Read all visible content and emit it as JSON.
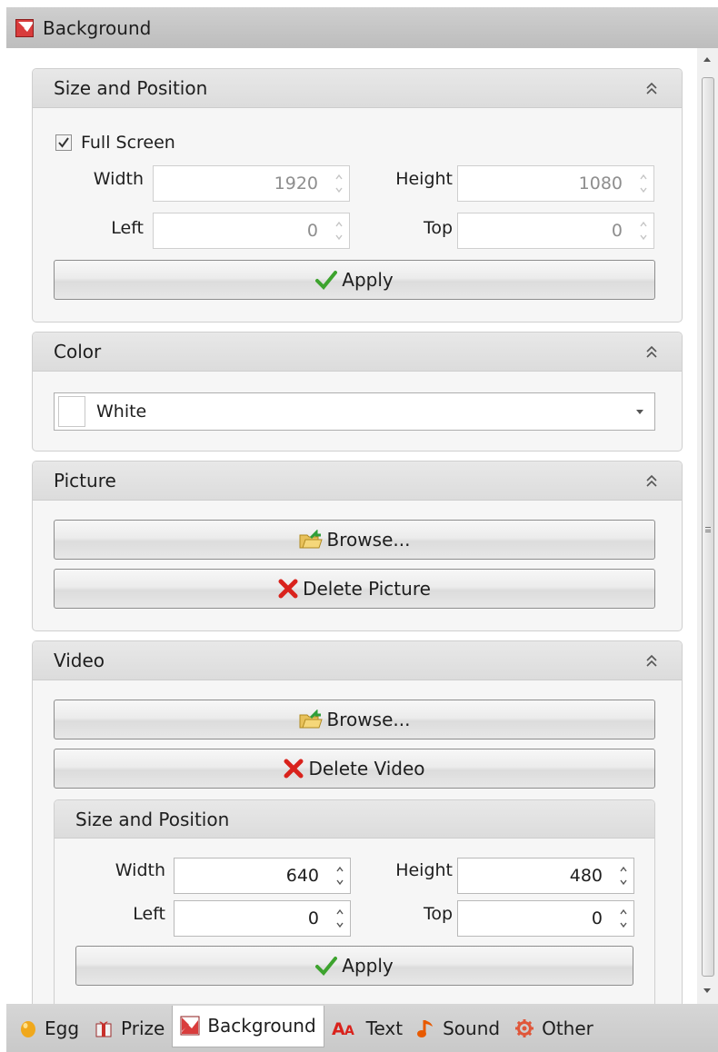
{
  "window": {
    "title": "Background",
    "title_icon": "background-app-icon"
  },
  "size_position": {
    "header": "Size and Position",
    "full_screen_label": "Full Screen",
    "full_screen_checked": true,
    "width_label": "Width",
    "width_value": "1920",
    "height_label": "Height",
    "height_value": "1080",
    "left_label": "Left",
    "left_value": "0",
    "top_label": "Top",
    "top_value": "0",
    "apply_label": "Apply"
  },
  "color": {
    "header": "Color",
    "selected": "White",
    "swatch": "#ffffff"
  },
  "picture": {
    "header": "Picture",
    "browse_label": "Browse...",
    "delete_label": "Delete Picture"
  },
  "video": {
    "header": "Video",
    "browse_label": "Browse...",
    "delete_label": "Delete Video",
    "size_position": {
      "header": "Size and Position",
      "width_label": "Width",
      "width_value": "640",
      "height_label": "Height",
      "height_value": "480",
      "left_label": "Left",
      "left_value": "0",
      "top_label": "Top",
      "top_value": "0",
      "apply_label": "Apply"
    }
  },
  "tabs": [
    {
      "label": "Egg",
      "icon": "egg-icon",
      "active": false
    },
    {
      "label": "Prize",
      "icon": "prize-icon",
      "active": false
    },
    {
      "label": "Background",
      "icon": "background-icon",
      "active": true
    },
    {
      "label": "Text",
      "icon": "text-icon",
      "active": false
    },
    {
      "label": "Sound",
      "icon": "sound-icon",
      "active": false
    },
    {
      "label": "Other",
      "icon": "gear-icon",
      "active": false
    }
  ],
  "colors": {
    "check": "#3da32e",
    "delete": "#d9221c",
    "accent_red": "#d93c3c",
    "egg": "#f0a81c",
    "sound": "#e85a00",
    "gear": "#e0573a"
  }
}
